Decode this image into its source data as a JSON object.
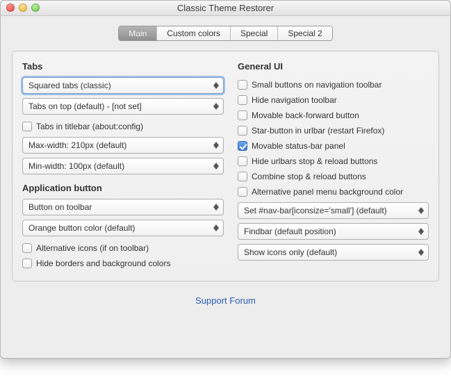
{
  "window": {
    "title": "Classic Theme Restorer"
  },
  "tabs": {
    "items": [
      "Main",
      "Custom colors",
      "Special",
      "Special 2"
    ],
    "active": 0
  },
  "left": {
    "tabs_section": {
      "title": "Tabs",
      "style_select": "Squared tabs (classic)",
      "position_select": "Tabs on top (default) - [not set]",
      "titlebar_checkbox": {
        "label": "Tabs in titlebar (about:config)",
        "checked": false
      },
      "maxwidth_select": "Max-width: 210px (default)",
      "minwidth_select": "Min-width: 100px (default)"
    },
    "appbutton_section": {
      "title": "Application button",
      "location_select": "Button on toolbar",
      "color_select": "Orange button color (default)",
      "alticons_checkbox": {
        "label": "Alternative icons (if on toolbar)",
        "checked": false
      },
      "hideborders_checkbox": {
        "label": "Hide borders and background colors",
        "checked": false
      }
    }
  },
  "right": {
    "title": "General UI",
    "checkboxes": [
      {
        "id": "small-buttons",
        "label": "Small buttons on navigation toolbar",
        "checked": false
      },
      {
        "id": "hide-navbar",
        "label": "Hide navigation toolbar",
        "checked": false
      },
      {
        "id": "movable-back-forward",
        "label": "Movable back-forward button",
        "checked": false
      },
      {
        "id": "star-urlbar",
        "label": "Star-button in urlbar (restart Firefox)",
        "checked": false
      },
      {
        "id": "movable-status",
        "label": "Movable status-bar panel",
        "checked": true
      },
      {
        "id": "hide-stop-reload",
        "label": "Hide urlbars stop & reload buttons",
        "checked": false
      },
      {
        "id": "combine-stop-reload",
        "label": "Combine stop & reload buttons",
        "checked": false
      },
      {
        "id": "alt-panel-bg",
        "label": "Alternative panel menu background color",
        "checked": false
      }
    ],
    "iconsize_select": "Set #nav-bar[iconsize='small'] (default)",
    "findbar_select": "Findbar (default position)",
    "showicons_select": "Show icons only (default)"
  },
  "footer": {
    "link": "Support Forum"
  }
}
